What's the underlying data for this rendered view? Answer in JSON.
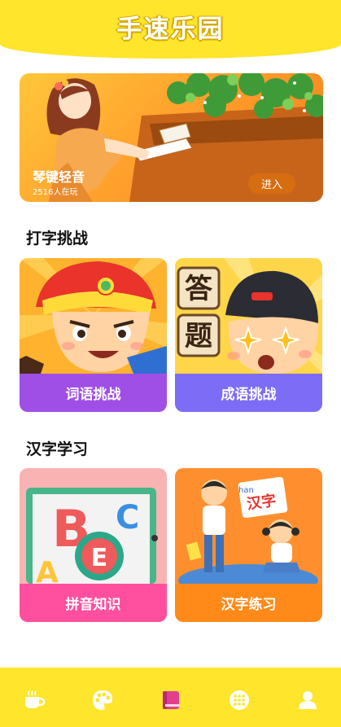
{
  "header": {
    "title": "手速乐园"
  },
  "banner": {
    "title": "琴键轻音",
    "subtitle": "2516人在玩",
    "enter_label": "进入"
  },
  "sections": [
    {
      "title": "打字挑战",
      "cards": [
        {
          "label": "词语挑战"
        },
        {
          "label": "成语挑战"
        }
      ]
    },
    {
      "title": "汉字学习",
      "cards": [
        {
          "label": "拼音知识"
        },
        {
          "label": "汉字练习"
        }
      ]
    }
  ],
  "art_text": {
    "answer_top": "答",
    "answer_bottom": "题",
    "pinyin_letters": [
      "B",
      "C",
      "E",
      "A"
    ],
    "hanzi_card": "汉字",
    "hanzi_pinyin": "han"
  },
  "tabbar": {
    "tabs": [
      {
        "icon": "coffee-icon",
        "active": false
      },
      {
        "icon": "palette-icon",
        "active": false
      },
      {
        "icon": "book-icon",
        "active": true
      },
      {
        "icon": "grid-dots-icon",
        "active": false
      },
      {
        "icon": "user-icon",
        "active": false
      }
    ],
    "active_color": "#e2408f",
    "inactive_color": "#ffffff"
  },
  "colors": {
    "header_bg": "#ffe52b",
    "banner_gradient_end": "#f07e1c",
    "card1_label_bg": "#a04fe6",
    "card2_label_bg": "#7d6cf5",
    "card3_label_bg": "#ff4f9e",
    "card4_label_bg": "#ff8a1a"
  }
}
